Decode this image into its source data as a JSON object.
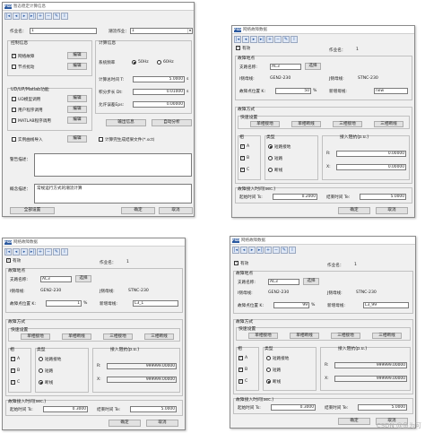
{
  "w1": {
    "title": "暂态稳定计算信息",
    "job_label": "作业名：",
    "job_value": "1",
    "sim_label": "潮流作业：",
    "sim_value": "1",
    "ctrl_title": "控制信息",
    "fault_cb": "网络故障",
    "fault_edit": "编辑",
    "node_cb": "节点扰动",
    "node_edit": "编辑",
    "ud_title": "UD/UP/Matlab功能",
    "ud_cb": "UD模型调用",
    "ud_edit": "编辑",
    "up_cb": "用户程序调用",
    "up_edit": "编辑",
    "matlab_cb": "MATLAB程序调用",
    "matlab_edit": "编辑",
    "calc_title": "计算信息",
    "freq_label": "系统频率",
    "freq_50": "50Hz",
    "freq_60": "60Hz",
    "total_time_label": "计算总时间 T:",
    "total_time_value": "5.0000",
    "step_label": "积分步长 Dt:",
    "step_value": "0.01000",
    "err_label": "允许误差Eps:",
    "err_value": "0.00000",
    "unit_s": "s",
    "output_btn": "输出信息",
    "auto_btn": "自动分析",
    "realtime_cb": "实例曲线导入",
    "realtime_edit": "编辑",
    "gen_cb": "计算完生成结果文件(*.sct)",
    "alarm_label": "警告描述：",
    "desc_label": "概念描述：",
    "desc_value": "常规运行方式的潮流计算",
    "all_btn": "全部设置",
    "ok_btn": "确定",
    "cancel_btn": "取消"
  },
  "w2": {
    "title": "网络故障数据",
    "valid": "有效",
    "job_label": "作业名：",
    "job_value": "1",
    "fault_loc_title": "故障地点",
    "branch_label": "支路名称:",
    "branch_value": "AC3",
    "select_btn": "选择",
    "i_bus_label": "I侧母线:",
    "i_bus_value": "GEN2-230",
    "j_bus_label": "J侧母线:",
    "j_bus_value": "STNC-230",
    "pos_label": "故障点位置 K:",
    "pos_value": "50",
    "pos_unit": "%",
    "new_bus_label": "新增母线:",
    "new_bus_value": "new",
    "mode_title": "故障方式",
    "quick_title": "快速设置",
    "single_ground": "单相接地",
    "single_break": "单相断线",
    "three_ground": "三相接地",
    "three_break": "三相断线",
    "phase_title": "相",
    "phase_a": "A",
    "phase_b": "B",
    "phase_c": "C",
    "type_title": "类型",
    "type_ground": "短路接地",
    "type_short": "短路",
    "type_break": "断线",
    "imp_title": "接入阻抗(p.u.)",
    "r_label": "R:",
    "r_value": "0.00000",
    "x_label": "X:",
    "x_value": "0.00000",
    "time_title": "故障接入时间(sec.)",
    "start_label": "起始时间 Ts:",
    "start_value": "0.2000",
    "end_label": "结束时间 Te:",
    "end_value": "5.0000",
    "ok_btn": "确定",
    "cancel_btn": "取消"
  },
  "w3": {
    "title": "网络故障数据",
    "valid": "有效",
    "job_label": "作业名：",
    "job_value": "1",
    "fault_loc_title": "故障地点",
    "branch_label": "支路名称:",
    "branch_value": "AC3",
    "select_btn": "选择",
    "i_bus_label": "I侧母线:",
    "i_bus_value": "GEN2-230",
    "j_bus_label": "J侧母线:",
    "j_bus_value": "STNC-230",
    "pos_label": "故障点位置 K:",
    "pos_value": "1",
    "pos_unit": "%",
    "new_bus_label": "新增母线:",
    "new_bus_value": "L3_1",
    "mode_title": "故障方式",
    "quick_title": "快速设置",
    "single_ground": "单相接地",
    "single_break": "单相断线",
    "three_ground": "三相接地",
    "three_break": "三相断线",
    "phase_title": "相",
    "phase_a": "A",
    "phase_b": "B",
    "phase_c": "C",
    "type_title": "类型",
    "type_ground": "短路接地",
    "type_short": "短路",
    "type_break": "断线",
    "imp_title": "接入阻抗(p.u.)",
    "r_label": "R:",
    "r_value": "999999.00000",
    "x_label": "X:",
    "x_value": "999999.00000",
    "time_title": "故障接入时间(sec.)",
    "start_label": "起始时间 Ts:",
    "start_value": "0.3000",
    "end_label": "结束时间 Te:",
    "end_value": "5.0000",
    "ok_btn": "确定",
    "cancel_btn": "取消"
  },
  "w4": {
    "title": "网络故障数据",
    "valid": "有效",
    "job_label": "作业名：",
    "job_value": "1",
    "fault_loc_title": "故障地点",
    "branch_label": "支路名称:",
    "branch_value": "AC3",
    "select_btn": "选择",
    "i_bus_label": "I侧母线:",
    "i_bus_value": "GEN2-230",
    "j_bus_label": "J侧母线:",
    "j_bus_value": "STNC-230",
    "pos_label": "故障点位置 K:",
    "pos_value": "99",
    "pos_unit": "%",
    "new_bus_label": "新增母线:",
    "new_bus_value": "L3_99",
    "mode_title": "故障方式",
    "quick_title": "快速设置",
    "single_ground": "单相接地",
    "single_break": "单相断线",
    "three_ground": "三相接地",
    "three_break": "三相断线",
    "phase_title": "相",
    "phase_a": "A",
    "phase_b": "B",
    "phase_c": "C",
    "type_title": "类型",
    "type_ground": "短路接地",
    "type_short": "短路",
    "type_break": "断线",
    "imp_title": "接入阻抗(p.u.)",
    "r_label": "R:",
    "r_value": "999999.00000",
    "x_label": "X:",
    "x_value": "999999.00000",
    "time_title": "故障接入时间(sec.)",
    "start_label": "起始时间 Ts:",
    "start_value": "0.3000",
    "end_label": "结束时间 Te:",
    "end_value": "5.0000",
    "ok_btn": "确定",
    "cancel_btn": "取消"
  },
  "watermark": "CSDN @鱼为可"
}
